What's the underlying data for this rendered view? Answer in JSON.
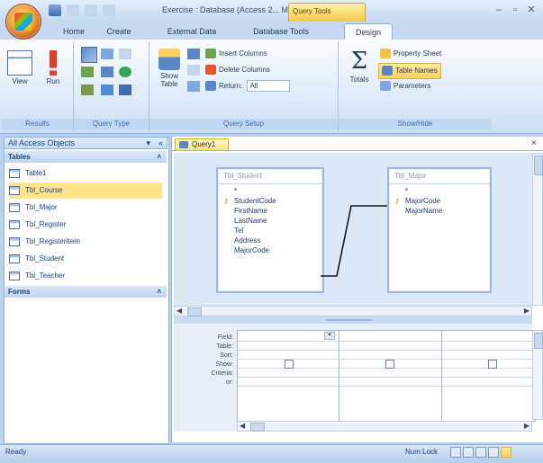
{
  "window": {
    "title": "Exercise : Database (Access 2... M",
    "context_tab": "Query Tools",
    "controls": [
      "–",
      "▫",
      "✕"
    ]
  },
  "tabs": [
    {
      "label": "Home"
    },
    {
      "label": "Create"
    },
    {
      "label": "External Data"
    },
    {
      "label": "Database Tools"
    },
    {
      "label": "Design"
    }
  ],
  "ribbon": {
    "results": {
      "label": "Results",
      "view": "View",
      "run": "Run"
    },
    "query_type": {
      "label": "Query Type"
    },
    "query_setup": {
      "label": "Query Setup",
      "show_table": "Show\nTable",
      "insert_columns": "Insert Columns",
      "delete_columns": "Delete Columns",
      "return": "Return:",
      "return_value": "All"
    },
    "show_hide": {
      "label": "Show/Hide",
      "totals": "Totals",
      "property_sheet": "Property Sheet",
      "table_names": "Table Names",
      "parameters": "Parameters"
    }
  },
  "nav": {
    "header": "All Access Objects",
    "tables_section": "Tables",
    "tables": [
      "Table1",
      "Tbl_Course",
      "Tbl_Major",
      "Tbl_Register",
      "Tbl_RegisterItem",
      "Tbl_Student",
      "Tbl_Teacher"
    ],
    "forms_section": "Forms"
  },
  "doc": {
    "tab_label": "Query1",
    "student_table": {
      "title": "Tbl_Student",
      "fields": [
        "*",
        "StudentCode",
        "FirstName",
        "LastName",
        "Tel",
        "Address",
        "MajorCode"
      ]
    },
    "major_table": {
      "title": "Tbl_Major",
      "fields": [
        "*",
        "MajorCode",
        "MajorName"
      ]
    },
    "qbe_rows": [
      "Field:",
      "Table:",
      "Sort:",
      "Show:",
      "Criteria:",
      "or:"
    ]
  },
  "status": {
    "text": "Ready",
    "num_lock": "Num Lock"
  },
  "colors": {
    "ribbon_bg": "#dfebf9",
    "accent_tab": "#f6c94a",
    "frame": "#bcd3ee"
  }
}
